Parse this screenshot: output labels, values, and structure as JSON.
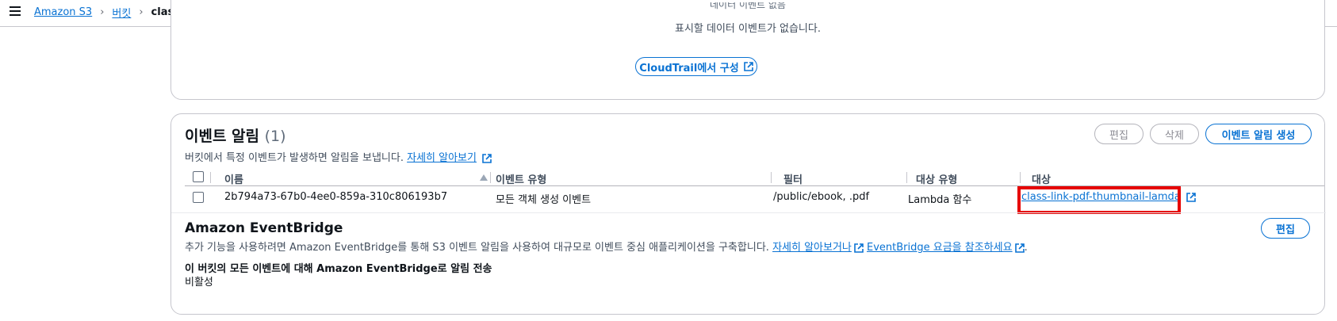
{
  "breadcrumb": {
    "items": [
      "Amazon S3",
      "버킷"
    ],
    "current": "class-link-bucket"
  },
  "trail_section": {
    "partial_heading": "데이터 이벤트 없음",
    "no_data_text": "표시할 데이터 이벤트가 없습니다.",
    "configure_button": "CloudTrail에서 구성"
  },
  "event_notifications": {
    "title": "이벤트 알림",
    "count": "(1)",
    "description": "버킷에서 특정 이벤트가 발생하면 알림을 보냅니다.",
    "learn_more": "자세히 알아보기",
    "buttons": {
      "edit": "편집",
      "delete": "삭제",
      "create": "이벤트 알림 생성"
    },
    "columns": [
      "이름",
      "이벤트 유형",
      "필터",
      "대상 유형",
      "대상"
    ],
    "rows": [
      {
        "name": "2b794a73-67b0-4ee0-859a-310c806193b7",
        "event_type": "모든 객체 생성 이벤트",
        "filter": "/public/ebook, .pdf",
        "destination_type": "Lambda 함수",
        "destination": "class-link-pdf-thumbnail-lamda"
      }
    ]
  },
  "eventbridge": {
    "title": "Amazon EventBridge",
    "edit_button": "편집",
    "description": "추가 기능을 사용하려면 Amazon EventBridge를 통해 S3 이벤트 알림을 사용하여 대규모로 이벤트 중심 애플리케이션을 구축합니다.",
    "learn_more": "자세히 알아보거나",
    "pricing_link": "EventBridge 요금을 참조하세요",
    "period": ".",
    "setting_label": "이 버킷의 모든 이벤트에 대해 Amazon EventBridge로 알림 전송",
    "setting_value": "비활성"
  },
  "colors": {
    "link": "#0972d3",
    "highlight": "#e60000",
    "border": "#c6c6cd"
  }
}
